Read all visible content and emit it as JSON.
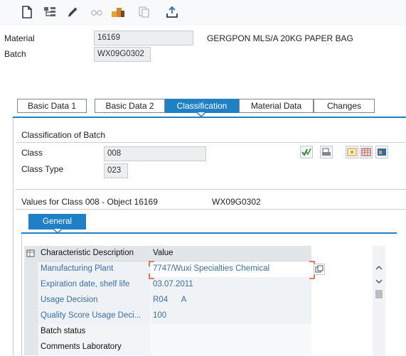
{
  "header": {
    "material_label": "Material",
    "material_value": "16169",
    "material_description": "GERGPON MLS/A 20KG PAPER BAG",
    "batch_label": "Batch",
    "batch_value": "WX09G0302"
  },
  "tabs": [
    {
      "label": "Basic Data 1",
      "active": false
    },
    {
      "label": "Basic Data 2",
      "active": false
    },
    {
      "label": "Classification",
      "active": true
    },
    {
      "label": "Material Data",
      "active": false
    },
    {
      "label": "Changes",
      "active": false
    }
  ],
  "classification": {
    "title": "Classification of Batch",
    "class_label": "Class",
    "class_value": "008",
    "class_type_label": "Class Type",
    "class_type_value": "023"
  },
  "values_section": {
    "title": "Values for Class 008 - Object 16169",
    "object": "WX09G0302",
    "general_tab": "General"
  },
  "table": {
    "col_description": "Characteristic Description",
    "col_value": "Value",
    "rows": [
      {
        "description": "Manufacturing Plant",
        "value": "7747/Wuxi Specialties Chemical",
        "highlight": true
      },
      {
        "description": "Expiration date, shelf life",
        "value": "03.07.2011",
        "highlight": true
      },
      {
        "description": "Usage Decision",
        "value": "R04      A",
        "highlight": true
      },
      {
        "description": "Quality Score Usage Deci...",
        "value": "100",
        "highlight": true
      },
      {
        "description": "Batch status",
        "value": "",
        "highlight": false
      },
      {
        "description": "Comments Laboratory",
        "value": "",
        "highlight": false
      }
    ]
  },
  "colors": {
    "accent": "#1f80c6",
    "link_text": "#3a6ea5",
    "highlight_red": "#e0583a"
  }
}
